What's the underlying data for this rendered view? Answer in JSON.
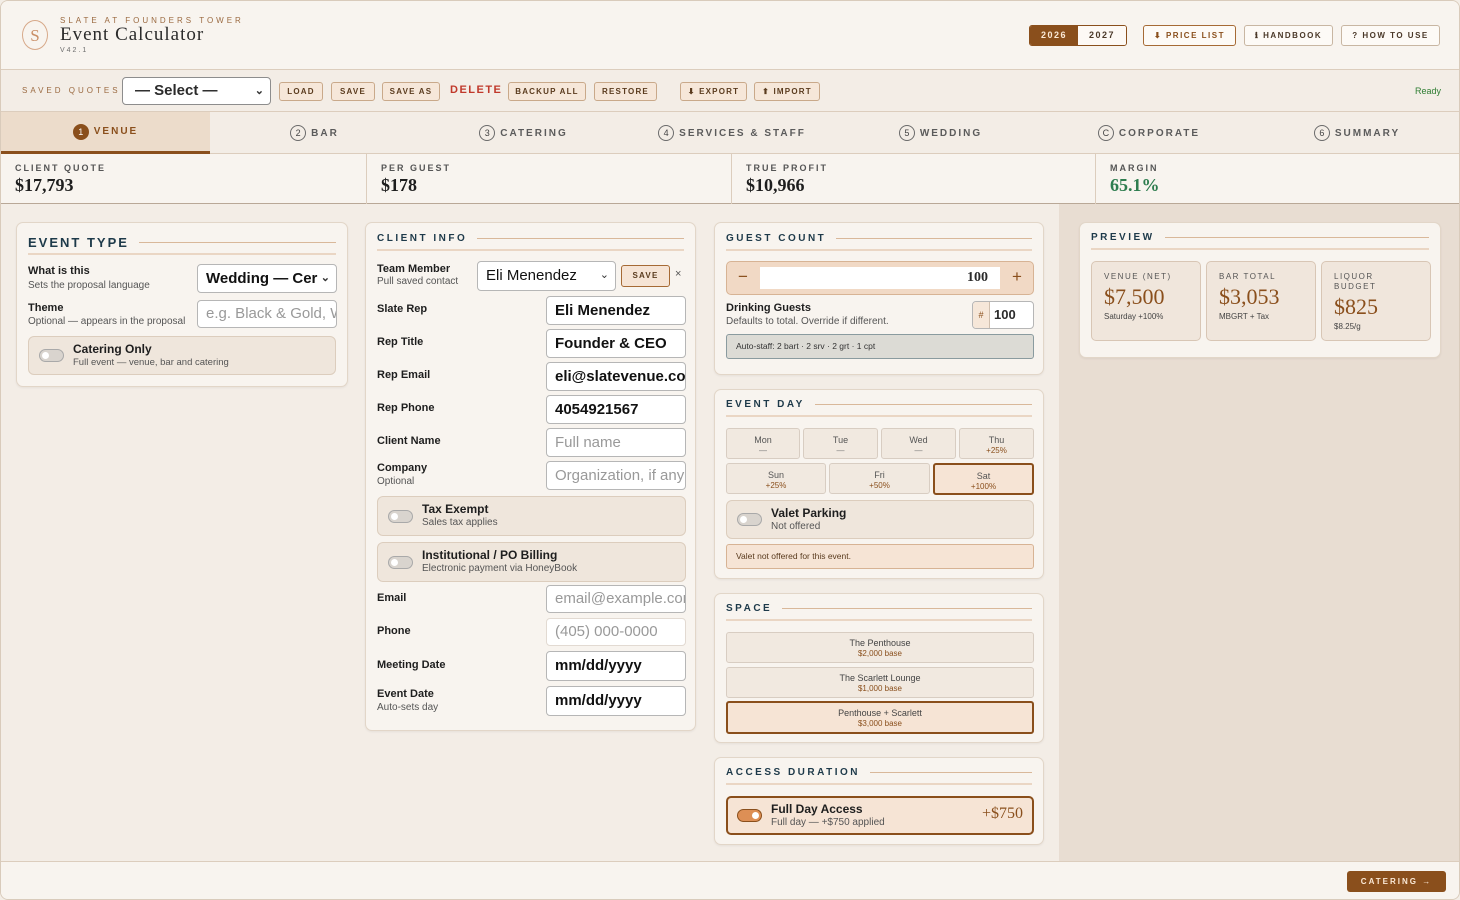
{
  "header": {
    "logo_letter": "S",
    "brand_sub": "SLATE AT FOUNDERS TOWER",
    "title": "Event Calculator",
    "version": "V42.1",
    "years": [
      "2026",
      "2027"
    ],
    "price_list": "⬇ PRICE LIST",
    "handbook": "ℹ HANDBOOK",
    "how_to": "? HOW TO USE"
  },
  "toolbar": {
    "label": "SAVED QUOTES",
    "select_value": "— Select —",
    "load": "LOAD",
    "save": "SAVE",
    "save_as": "SAVE AS",
    "delete": "DELETE",
    "backup": "BACKUP ALL",
    "restore": "RESTORE",
    "export": "⬇ EXPORT",
    "import": "⬆ IMPORT",
    "status": "Ready"
  },
  "tabs": [
    {
      "num": "1",
      "label": "VENUE"
    },
    {
      "num": "2",
      "label": "BAR"
    },
    {
      "num": "3",
      "label": "CATERING"
    },
    {
      "num": "4",
      "label": "SERVICES & STAFF"
    },
    {
      "num": "5",
      "label": "WEDDING"
    },
    {
      "num": "C",
      "label": "CORPORATE"
    },
    {
      "num": "6",
      "label": "SUMMARY"
    }
  ],
  "stats": [
    {
      "label": "CLIENT QUOTE",
      "value": "$17,793"
    },
    {
      "label": "PER GUEST",
      "value": "$178"
    },
    {
      "label": "TRUE PROFIT",
      "value": "$10,966"
    },
    {
      "label": "MARGIN",
      "value": "65.1%"
    }
  ],
  "event_type": {
    "title": "EVENT TYPE",
    "what_label": "What is this",
    "what_sub": "Sets the proposal language",
    "what_value": "Wedding — Cer",
    "theme_label": "Theme",
    "theme_sub": "Optional — appears in the proposal",
    "theme_placeholder": "e.g. Black & Gold, W",
    "catering_title": "Catering Only",
    "catering_sub": "Full event — venue, bar and catering"
  },
  "client": {
    "title": "CLIENT INFO",
    "team_label": "Team Member",
    "team_sub": "Pull saved contact",
    "team_value": "Eli Menendez",
    "save": "SAVE",
    "close": "×",
    "rep_label": "Slate Rep",
    "rep_value": "Eli Menendez",
    "title_label": "Rep Title",
    "title_value": "Founder & CEO",
    "email_label": "Rep Email",
    "email_value": "eli@slatevenue.com",
    "phone_label": "Rep Phone",
    "phone_value": "4054921567",
    "client_name_label": "Client Name",
    "client_name_ph": "Full name",
    "company_label": "Company",
    "company_sub": "Optional",
    "company_ph": "Organization, if any",
    "tax_title": "Tax Exempt",
    "tax_sub": "Sales tax applies",
    "po_title": "Institutional / PO Billing",
    "po_sub": "Electronic payment via HoneyBook",
    "cemail_label": "Email",
    "cemail_ph": "email@example.com",
    "cphone_label": "Phone",
    "cphone_ph": "(405) 000-0000",
    "meeting_label": "Meeting Date",
    "meeting_value": "mm/dd/yyyy",
    "event_label": "Event Date",
    "event_sub": "Auto-sets day",
    "event_value": "mm/dd/yyyy"
  },
  "guests": {
    "title": "GUEST COUNT",
    "minus": "−",
    "plus": "+",
    "count": "100",
    "drinking_label": "Drinking Guests",
    "drinking_sub": "Defaults to total. Override if different.",
    "hash": "#",
    "drinking_value": "100",
    "autostaff": "Auto-staff: 2 bart · 2 srv · 2 grt · 1 cpt"
  },
  "event_day": {
    "title": "EVENT DAY",
    "days_row1": [
      {
        "d": "Mon",
        "p": "—"
      },
      {
        "d": "Tue",
        "p": "—"
      },
      {
        "d": "Wed",
        "p": "—"
      },
      {
        "d": "Thu",
        "p": "+25%"
      }
    ],
    "days_row2": [
      {
        "d": "Sun",
        "p": "+25%"
      },
      {
        "d": "Fri",
        "p": "+50%"
      },
      {
        "d": "Sat",
        "p": "+100%"
      }
    ],
    "valet_title": "Valet Parking",
    "valet_sub": "Not offered",
    "valet_note": "Valet not offered for this event."
  },
  "space": {
    "title": "SPACE",
    "options": [
      {
        "name": "The Penthouse",
        "price": "$2,000 base"
      },
      {
        "name": "The Scarlett Lounge",
        "price": "$1,000 base"
      },
      {
        "name": "Penthouse + Scarlett",
        "price": "$3,000 base"
      }
    ]
  },
  "access": {
    "title": "ACCESS DURATION",
    "name": "Full Day Access",
    "sub": "Full day — +$750 applied",
    "price": "+$750"
  },
  "preview": {
    "title": "PREVIEW",
    "items": [
      {
        "label": "VENUE (NET)",
        "value": "$7,500",
        "sub": "Saturday +100%"
      },
      {
        "label": "BAR TOTAL",
        "value": "$3,053",
        "sub": "MBGRT + Tax"
      },
      {
        "label": "LIQUOR BUDGET",
        "value": "$825",
        "sub": "$8.25/g"
      }
    ]
  },
  "footer": {
    "next": "CATERING →"
  },
  "colors": {
    "accent": "#8a4f1c",
    "margin_green": "#2e7d4f",
    "delete_red": "#c0392b",
    "title_blue": "#1e3a4a"
  }
}
